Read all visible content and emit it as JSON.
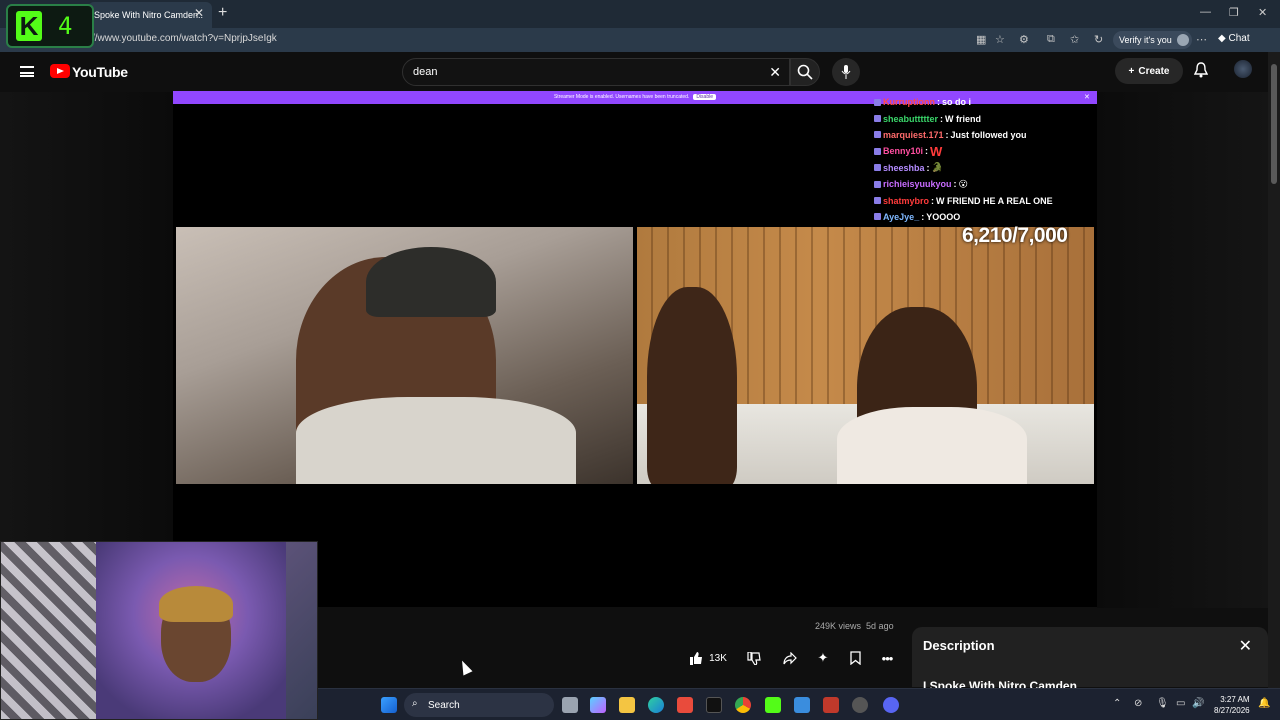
{
  "browser": {
    "kick_badge_number": "4",
    "tab_title": "Spoke With Nitro Camden..",
    "tab_close": "✕",
    "new_tab": "+",
    "url": "//www.youtube.com/watch?v=NprjpJseIgk",
    "verify_label": "Verify it's you",
    "chat_label": "Chat"
  },
  "youtube": {
    "logo_text": "YouTube",
    "search_value": "dean",
    "create_label": "Create",
    "stream_banner": "Streamer Mode is enabled. Usernames have been truncated.",
    "stream_banner_disable": "Disable",
    "sub_count": "6,210/7,000",
    "chat": [
      {
        "user": "Kurruptionn",
        "user_color": "#ff4a4a",
        "msg": "so do i"
      },
      {
        "user": "sheabuttttter",
        "user_color": "#3ad66a",
        "msg": "W friend"
      },
      {
        "user": "marquiest.171",
        "user_color": "#ff6b6b",
        "msg": "Just followed you"
      },
      {
        "user": "Benny10i",
        "user_color": "#ff4fa0",
        "msg": "W"
      },
      {
        "user": "sheeshba",
        "user_color": "#b48cff",
        "msg": "🐊"
      },
      {
        "user": "richieisyuukyou",
        "user_color": "#c86cff",
        "msg": "😮"
      },
      {
        "user": "shatmybro",
        "user_color": "#ff3b3b",
        "msg": "W FRIEND HE A REAL ONE"
      },
      {
        "user": "AyeJye_",
        "user_color": "#7fb8ff",
        "msg": "YOOOO"
      }
    ],
    "views": "249K views",
    "age": "5d ago",
    "like_count": "13K",
    "description_title": "Description",
    "description_text": "I Spoke With Nitro Camden"
  },
  "taskbar": {
    "search_label": "Search",
    "time": "3:27 AM",
    "date": "8/27/2026"
  }
}
